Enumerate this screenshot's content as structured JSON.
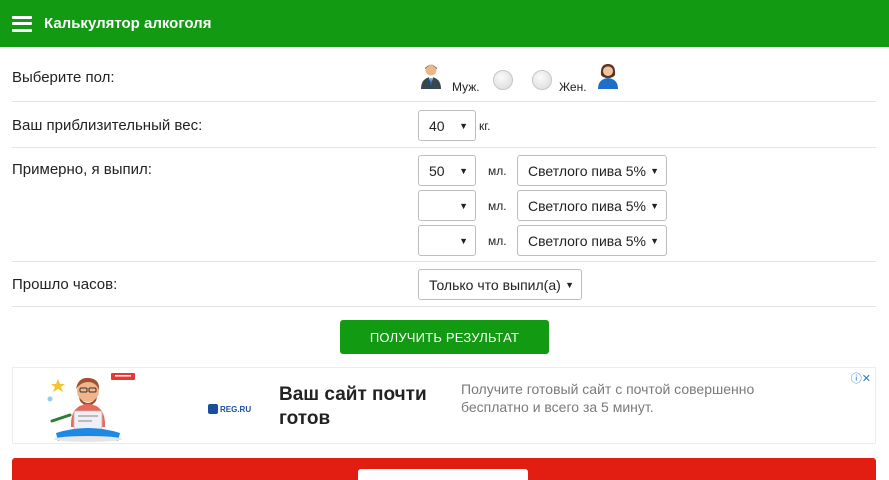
{
  "header": {
    "title": "Калькулятор алкоголя"
  },
  "gender": {
    "label": "Выберите пол:",
    "male": "Муж.",
    "female": "Жен."
  },
  "weight": {
    "label": "Ваш приблизительный вес:",
    "value": "40",
    "unit": "кг."
  },
  "drinks": {
    "label": "Примерно, я выпил:",
    "unit": "мл.",
    "rows": [
      {
        "amount": "50",
        "type": "Светлого пива 5%"
      },
      {
        "amount": "",
        "type": "Светлого пива 5%"
      },
      {
        "amount": "",
        "type": "Светлого пива 5%"
      }
    ]
  },
  "hours": {
    "label": "Прошло часов:",
    "value": "Только что выпил(а)"
  },
  "submit_label": "ПОЛУЧИТЬ РЕЗУЛЬТАТ",
  "ad": {
    "brand": "REG.RU",
    "headline": "Ваш сайт почти готов",
    "description": "Получите готовый сайт с почтой совершенно бесплатно и всего за 5 минут."
  },
  "colors": {
    "primary_green": "#129a12",
    "banner_red": "#e21d12",
    "ad_text_gray": "#7a7a7a"
  }
}
